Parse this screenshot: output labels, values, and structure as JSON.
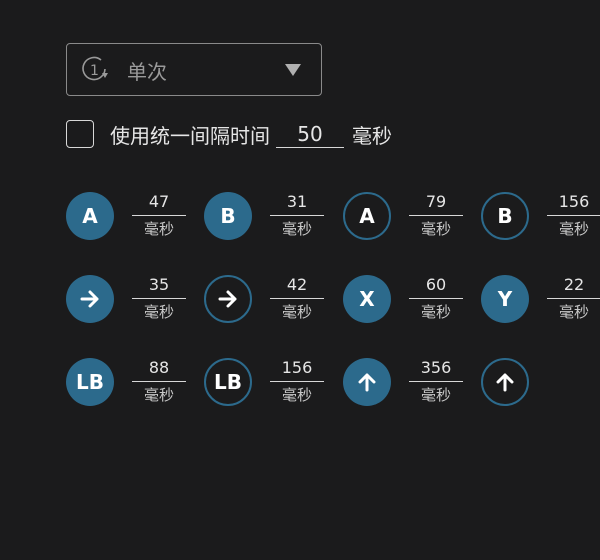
{
  "dropdown": {
    "icon": "repeat-once-icon",
    "icon_text": "1",
    "value": "单次"
  },
  "interval": {
    "label": "使用统一间隔时间",
    "value": "50",
    "unit": "毫秒"
  },
  "accent_color": "#2c6a8c",
  "rows": [
    [
      {
        "label": "A",
        "style": "filled",
        "icon": null,
        "time": "47",
        "unit": "毫秒"
      },
      {
        "label": "B",
        "style": "filled",
        "icon": null,
        "time": "31",
        "unit": "毫秒"
      },
      {
        "label": "A",
        "style": "outline",
        "icon": null,
        "time": "79",
        "unit": "毫秒"
      },
      {
        "label": "B",
        "style": "outline",
        "icon": null,
        "time": "156",
        "unit": "毫秒"
      }
    ],
    [
      {
        "label": "",
        "style": "filled",
        "icon": "arrow-right-icon",
        "time": "35",
        "unit": "毫秒"
      },
      {
        "label": "",
        "style": "outline",
        "icon": "arrow-right-icon",
        "time": "42",
        "unit": "毫秒"
      },
      {
        "label": "X",
        "style": "filled",
        "icon": null,
        "time": "60",
        "unit": "毫秒"
      },
      {
        "label": "Y",
        "style": "filled",
        "icon": null,
        "time": "22",
        "unit": "毫秒"
      }
    ],
    [
      {
        "label": "LB",
        "style": "filled",
        "icon": null,
        "time": "88",
        "unit": "毫秒"
      },
      {
        "label": "LB",
        "style": "outline",
        "icon": null,
        "time": "156",
        "unit": "毫秒"
      },
      {
        "label": "",
        "style": "filled",
        "icon": "arrow-up-icon",
        "time": "356",
        "unit": "毫秒"
      },
      {
        "label": "",
        "style": "outline",
        "icon": "arrow-up-icon",
        "time": null,
        "unit": null
      }
    ]
  ]
}
